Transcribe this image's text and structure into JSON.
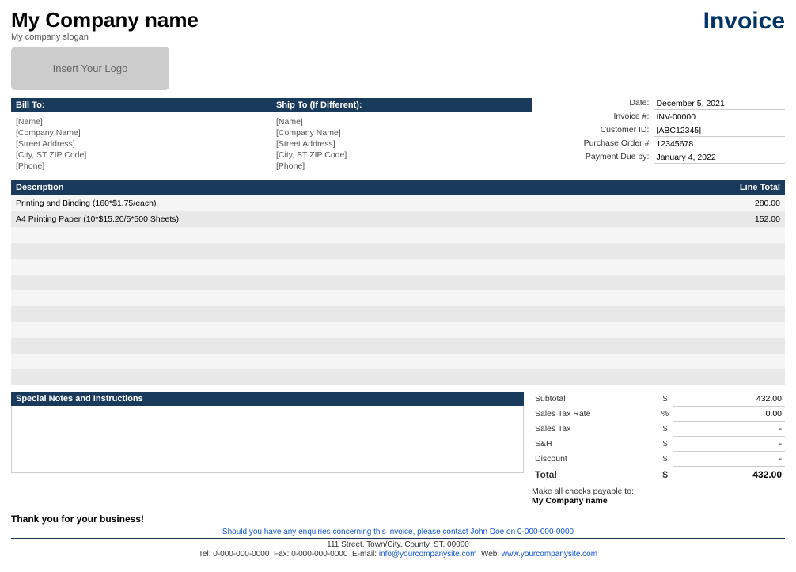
{
  "company": {
    "name": "My Company name",
    "slogan": "My company slogan",
    "logo_placeholder": "Insert Your Logo"
  },
  "invoice_title": "Invoice",
  "bill_to": {
    "header": "Bill To:",
    "name": "[Name]",
    "company": "[Company Name]",
    "street": "[Street Address]",
    "city": "[City, ST ZIP Code]",
    "phone": "[Phone]"
  },
  "ship_to": {
    "header": "Ship To (If Different):",
    "name": "[Name]",
    "company": "[Company Name]",
    "street": "[Street Address]",
    "city": "[City, ST ZIP Code]",
    "phone": "[Phone]"
  },
  "meta": {
    "date_label": "Date:",
    "date_value": "December 5, 2021",
    "invoice_label": "Invoice #:",
    "invoice_value": "INV-00000",
    "customer_label": "Customer ID:",
    "customer_value": "[ABC12345]",
    "po_label": "Purchase Order #",
    "po_value": "12345678",
    "due_label": "Payment Due by:",
    "due_value": "January 4, 2022"
  },
  "table": {
    "col_description": "Description",
    "col_line_total": "Line Total",
    "rows": [
      {
        "description": "Printing and Binding (160*$1.75/each)",
        "line_total": "280.00"
      },
      {
        "description": "A4 Printing Paper (10*$15.20/5*500 Sheets)",
        "line_total": "152.00"
      },
      {
        "description": "",
        "line_total": ""
      },
      {
        "description": "",
        "line_total": ""
      },
      {
        "description": "",
        "line_total": ""
      },
      {
        "description": "",
        "line_total": ""
      },
      {
        "description": "",
        "line_total": ""
      },
      {
        "description": "",
        "line_total": ""
      },
      {
        "description": "",
        "line_total": ""
      },
      {
        "description": "",
        "line_total": ""
      },
      {
        "description": "",
        "line_total": ""
      },
      {
        "description": "",
        "line_total": ""
      }
    ]
  },
  "notes": {
    "header": "Special Notes and Instructions"
  },
  "totals": {
    "subtotal_label": "Subtotal",
    "subtotal_currency": "$",
    "subtotal_value": "432.00",
    "tax_rate_label": "Sales Tax Rate",
    "tax_rate_currency": "%",
    "tax_rate_value": "0.00",
    "sales_tax_label": "Sales Tax",
    "sales_tax_currency": "$",
    "sales_tax_value": "-",
    "sh_label": "S&H",
    "sh_currency": "$",
    "sh_value": "-",
    "discount_label": "Discount",
    "discount_currency": "$",
    "discount_value": "-",
    "total_label": "Total",
    "total_currency": "$",
    "total_value": "432.00"
  },
  "payable": {
    "label": "Make all checks payable to:",
    "company": "My Company name"
  },
  "footer": {
    "thank_you": "Thank you for your business!",
    "enquiry": "Should you have any enquiries concerning this invoice, please contact John Doe on 0-000-000-0000",
    "address": "111 Street, Town/City, County, ST, 00000",
    "tel": "Tel: 0-000-000-0000",
    "fax": "Fax: 0-000-000-0000",
    "email_label": "E-mail:",
    "email": "info@yourcompanysite.com",
    "web_label": "Web:",
    "web": "www.yourcompanysite.com"
  }
}
